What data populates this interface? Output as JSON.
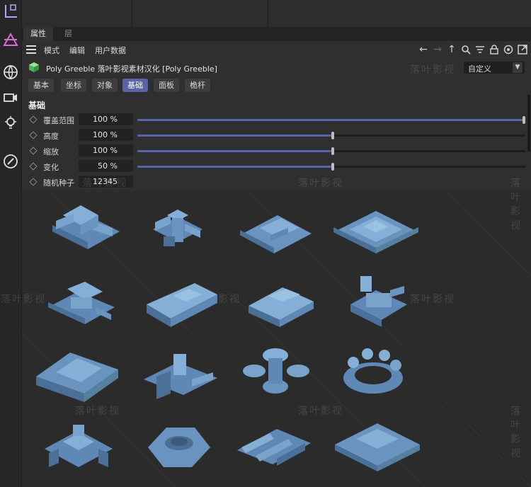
{
  "window": {
    "tabs": [
      {
        "label": "属性",
        "active": true
      },
      {
        "label": "层",
        "active": false
      }
    ]
  },
  "menu": [
    "模式",
    "编辑",
    "用户数据"
  ],
  "nav_icons": [
    "arrow-left-icon",
    "arrow-right-icon",
    "arrow-up-icon",
    "search-icon",
    "filter-icon",
    "lock-icon",
    "target-icon",
    "new-window-icon"
  ],
  "object": {
    "name": "Poly Greeble  落叶影视素材汉化 [Poly Greeble]",
    "mode": "自定义"
  },
  "buttons": [
    {
      "label": "基本",
      "active": false
    },
    {
      "label": "坐标",
      "active": false
    },
    {
      "label": "对象",
      "active": false
    },
    {
      "label": "基础",
      "active": true
    },
    {
      "label": "面板",
      "active": false
    },
    {
      "label": "桅杆",
      "active": false
    }
  ],
  "section": {
    "title": "基础",
    "params": [
      {
        "label": "覆盖范围",
        "value": "100 %",
        "level": 1.0
      },
      {
        "label": "高度",
        "value": "100 %",
        "level": 0.5
      },
      {
        "label": "缩放",
        "value": "100 %",
        "level": 0.5
      },
      {
        "label": "变化",
        "value": "50 %",
        "level": 0.5
      },
      {
        "label": "随机种子",
        "value": "12345"
      }
    ]
  },
  "watermark": "落叶影视",
  "colors": {
    "accent": "#5a63a6",
    "model": "#6e98c4"
  }
}
